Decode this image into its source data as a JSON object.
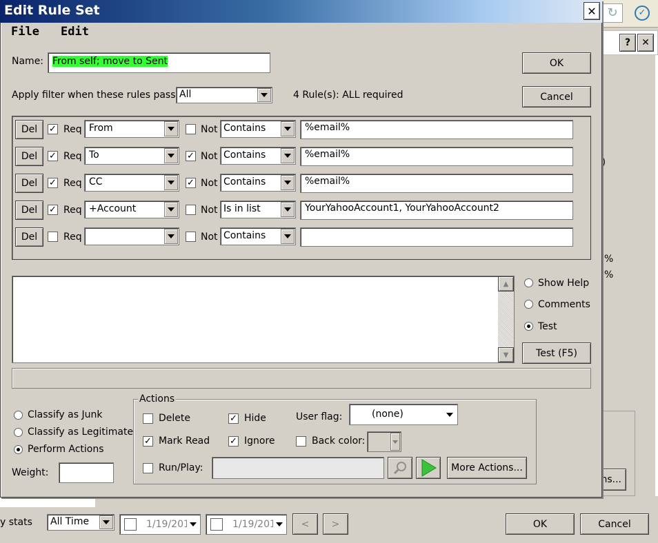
{
  "window": {
    "title": "Edit Rule Set",
    "close_glyph": "✕"
  },
  "menu": {
    "file": "File",
    "edit": "Edit"
  },
  "name": {
    "label": "Name:",
    "value": "From self; move to Sent",
    "highlight": "#33ff33"
  },
  "buttons": {
    "ok": "OK",
    "cancel": "Cancel",
    "test": "Test (F5)",
    "more_actions": "More Actions..."
  },
  "apply": {
    "label": "Apply filter when these rules pass:",
    "value": "All",
    "summary": "4 Rule(s): ALL required"
  },
  "rules": [
    {
      "del": "Del",
      "req_checked": true,
      "req": "Req",
      "field": "From",
      "not_checked": false,
      "not": "Not",
      "op": "Contains",
      "value": "%email%"
    },
    {
      "del": "Del",
      "req_checked": true,
      "req": "Req",
      "field": "To",
      "not_checked": true,
      "not": "Not",
      "op": "Contains",
      "value": "%email%"
    },
    {
      "del": "Del",
      "req_checked": true,
      "req": "Req",
      "field": "CC",
      "not_checked": true,
      "not": "Not",
      "op": "Contains",
      "value": "%email%"
    },
    {
      "del": "Del",
      "req_checked": true,
      "req": "Req",
      "field": "+Account",
      "not_checked": false,
      "not": "Not",
      "op": "Is in list",
      "value": "YourYahooAccount1, YourYahooAccount2"
    },
    {
      "del": "Del",
      "req_checked": false,
      "req": "Req",
      "field": "",
      "not_checked": false,
      "not": "Not",
      "op": "Contains",
      "value": ""
    }
  ],
  "view_options": {
    "show_help": "Show Help",
    "comments": "Comments",
    "test": "Test",
    "selected": "test"
  },
  "classify": {
    "junk": "Classify as Junk",
    "legit": "Classify as Legitimate",
    "perform": "Perform Actions",
    "selected": "perform",
    "weight_label": "Weight:",
    "weight_value": ""
  },
  "actions": {
    "legend": "Actions",
    "delete": "Delete",
    "delete_checked": false,
    "hide": "Hide",
    "hide_checked": true,
    "mark_read": "Mark Read",
    "mark_read_checked": true,
    "ignore": "Ignore",
    "ignore_checked": true,
    "user_flag_label": "User flag:",
    "user_flag_value": "(none)",
    "back_color_label": "Back color:",
    "back_color_checked": false,
    "run_play": "Run/Play:",
    "run_play_checked": false,
    "run_play_value": ""
  },
  "background": {
    "stats_label": "y stats",
    "period": "All Time",
    "date1": "1/19/201",
    "date2": "1/19/201",
    "prev": "<",
    "next": ">",
    "ok": "OK",
    "cancel": "Cancel",
    "side_btn": "ns...",
    "help": "?",
    "close": "✕",
    "pct1": "%",
    "pct2": "%",
    "frag": ")"
  }
}
